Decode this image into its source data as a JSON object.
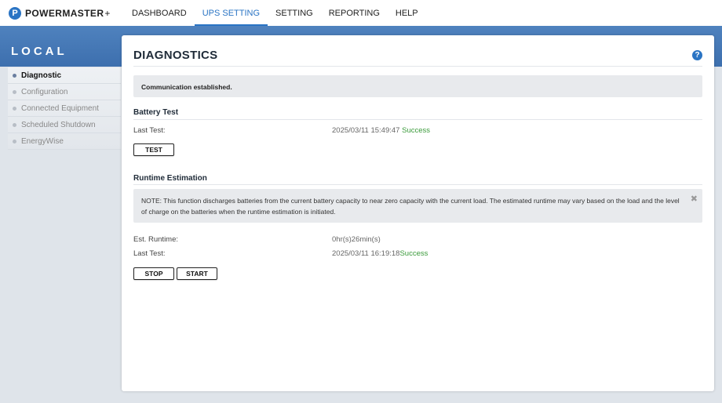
{
  "brand": {
    "name": "POWERMASTER",
    "plus": "+",
    "logo_letter": "P"
  },
  "nav": [
    {
      "label": "DASHBOARD",
      "active": false
    },
    {
      "label": "UPS SETTING",
      "active": true
    },
    {
      "label": "SETTING",
      "active": false
    },
    {
      "label": "REPORTING",
      "active": false
    },
    {
      "label": "HELP",
      "active": false
    }
  ],
  "sidebar": {
    "title": "LOCAL",
    "items": [
      {
        "label": "Diagnostic",
        "active": true
      },
      {
        "label": "Configuration",
        "active": false
      },
      {
        "label": "Connected Equipment",
        "active": false
      },
      {
        "label": "Scheduled Shutdown",
        "active": false
      },
      {
        "label": "EnergyWise",
        "active": false
      }
    ]
  },
  "panel": {
    "title": "DIAGNOSTICS",
    "help_symbol": "?",
    "communication": "Communication established.",
    "battery_test": {
      "title": "Battery Test",
      "last_test_label": "Last Test:",
      "last_test_time": "2025/03/11 15:49:47",
      "last_test_result": "Success",
      "test_button": "TEST"
    },
    "runtime": {
      "title": "Runtime Estimation",
      "note": "NOTE: This function discharges batteries from the current battery capacity to near zero capacity with the current load. The estimated runtime may vary based on the load and the level of charge on the batteries when the runtime estimation is initiated.",
      "close_symbol": "✖",
      "est_label": "Est. Runtime:",
      "est_value": "0hr(s)26min(s)",
      "last_test_label": "Last Test:",
      "last_test_time": "2025/03/11 16:19:18",
      "last_test_result": "Success",
      "stop_button": "STOP",
      "start_button": "START"
    }
  },
  "colors": {
    "accent": "#2a74c4",
    "band": "#4a7cba",
    "success": "#3a9a3a"
  }
}
